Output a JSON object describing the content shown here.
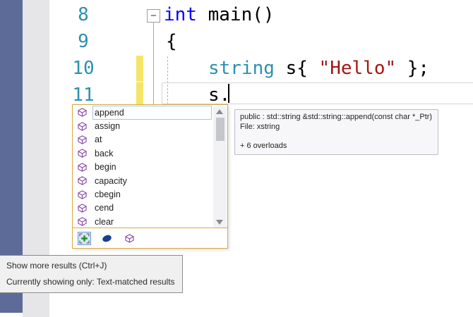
{
  "editor": {
    "fold_marker": "−",
    "lines": [
      {
        "number": "8",
        "segments": [
          {
            "text": "int"
          },
          {
            "text": " main()"
          }
        ]
      },
      {
        "number": "9",
        "segments": [
          {
            "text": "{"
          }
        ]
      },
      {
        "number": "10",
        "segments": [
          {
            "text": "string"
          },
          {
            "text": " s{ "
          },
          {
            "text": "\"Hello\""
          },
          {
            "text": " };"
          }
        ]
      },
      {
        "number": "11",
        "segments": [
          {
            "text": "s."
          }
        ]
      }
    ],
    "colors": {
      "nav_strip": "#5D6B99",
      "gutter_strip": "#E6E6E9",
      "line_number": "#2B91AF",
      "keyword": "#0000FF",
      "type_name": "#2B91AF",
      "string_literal": "#A31515",
      "change_bar": "#F5E567",
      "current_line_border": "#D4D4DC"
    }
  },
  "completion": {
    "items": [
      "append",
      "assign",
      "at",
      "back",
      "begin",
      "capacity",
      "cbegin",
      "cend",
      "clear"
    ],
    "selected_item": "append",
    "item_icon": "method-cube-icon",
    "border_color": "#D9A843",
    "selection_border_color": "#A6C7E7",
    "toolbar_icons": [
      "expand-results-icon",
      "keyword-filter-icon",
      "method-filter-icon"
    ]
  },
  "signature_tooltip": {
    "signature": "public : std::string &std::string::append(const char *_Ptr)",
    "file": "File: xstring",
    "overloads": "+ 6 overloads"
  },
  "status_tooltip": {
    "line1": "Show more results (Ctrl+J)",
    "line2": "Currently showing only: Text-matched results"
  }
}
